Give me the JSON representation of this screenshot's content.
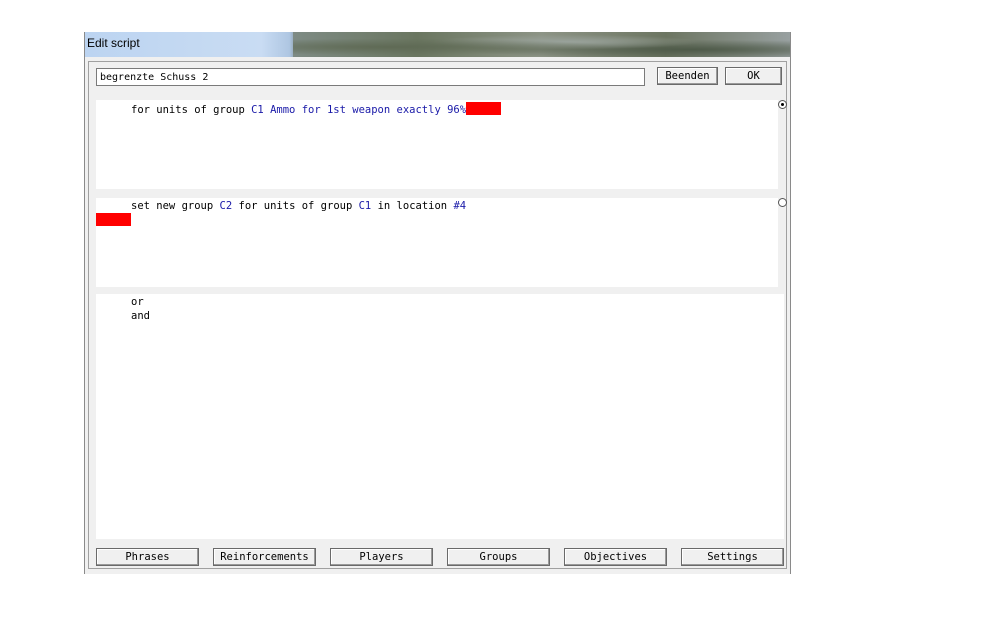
{
  "window": {
    "title": "Edit script"
  },
  "script_name": {
    "value": "begrenzte Schuss 2"
  },
  "buttons": {
    "cancel": "Beenden",
    "ok": "OK"
  },
  "condition": {
    "parts": [
      "for units of group ",
      "C1",
      " Ammo for 1st weapon exactly 96%"
    ],
    "selected": true
  },
  "action": {
    "parts": [
      "set new group ",
      "C2",
      " for units of group ",
      "C1",
      " in location ",
      "#4"
    ],
    "selected": false
  },
  "operators": [
    "or",
    "and"
  ],
  "tabs": [
    "Phrases",
    "Reinforcements",
    "Players",
    "Groups",
    "Objectives",
    "Settings"
  ],
  "colors": {
    "highlight": "#ff0000",
    "keyword": "#1a1aa8"
  }
}
